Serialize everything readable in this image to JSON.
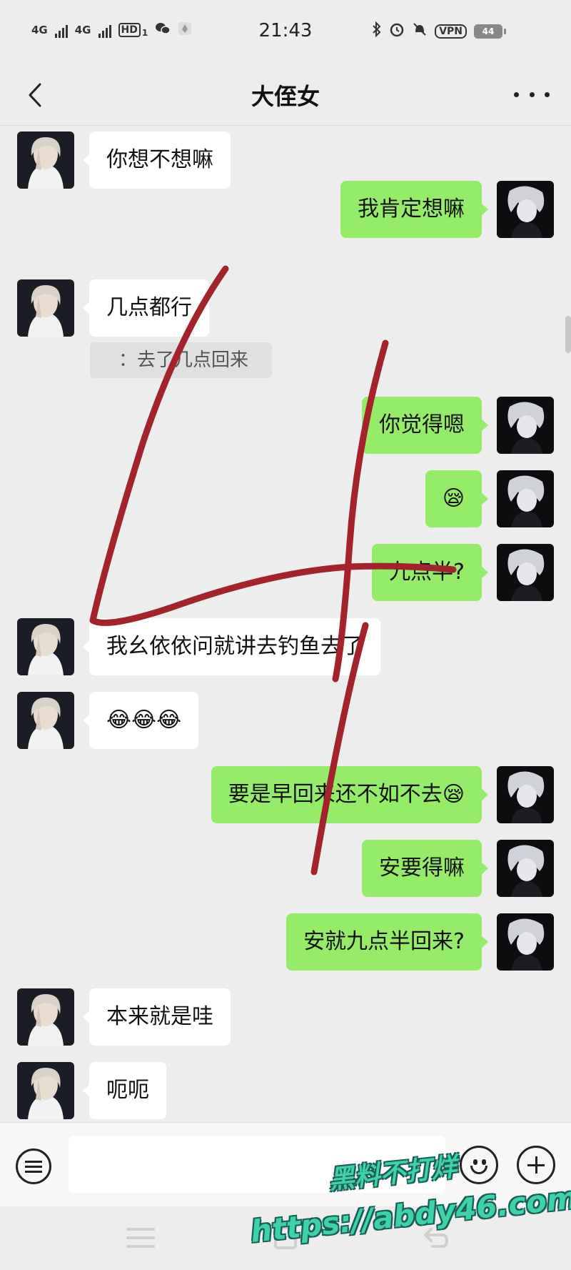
{
  "status_bar": {
    "network_1": "4G",
    "network_2": "4G",
    "hd_badge": "HD",
    "sim_index": "1",
    "time": "21:43",
    "vpn_label": "VPN",
    "battery_level": "44"
  },
  "header": {
    "title": "大侄女"
  },
  "messages": [
    {
      "side": "left",
      "text": "你想不想嘛"
    },
    {
      "side": "right",
      "text": "我肯定想嘛"
    },
    {
      "side": "left",
      "text": "几点都行"
    },
    {
      "side": "left",
      "quote": "：去了几点回来"
    },
    {
      "side": "right",
      "text": "你觉得嗯"
    },
    {
      "side": "right",
      "text": "😪"
    },
    {
      "side": "right",
      "text": "九点半?"
    },
    {
      "side": "left",
      "text": "我幺依依问就讲去钓鱼去了"
    },
    {
      "side": "left",
      "text": "😂😂😂"
    },
    {
      "side": "right",
      "text": "要是早回来还不如不去😪"
    },
    {
      "side": "right",
      "text": "安要得嘛"
    },
    {
      "side": "right",
      "text": "安就九点半回来?"
    },
    {
      "side": "left",
      "text": "本来就是哇"
    },
    {
      "side": "left",
      "text": "呃呃"
    }
  ],
  "input_bar": {
    "value": "",
    "icons": [
      "voice-icon",
      "emoji-icon",
      "plus-icon"
    ]
  },
  "watermark": {
    "line1": "黑料不打烊",
    "line2": "https://abdy46.com"
  },
  "colors": {
    "background": "#ededed",
    "my_bubble": "#95ec69",
    "their_bubble": "#ffffff",
    "annotation_stroke": "#a3222c",
    "watermark_fill": "#3fd2a8"
  }
}
